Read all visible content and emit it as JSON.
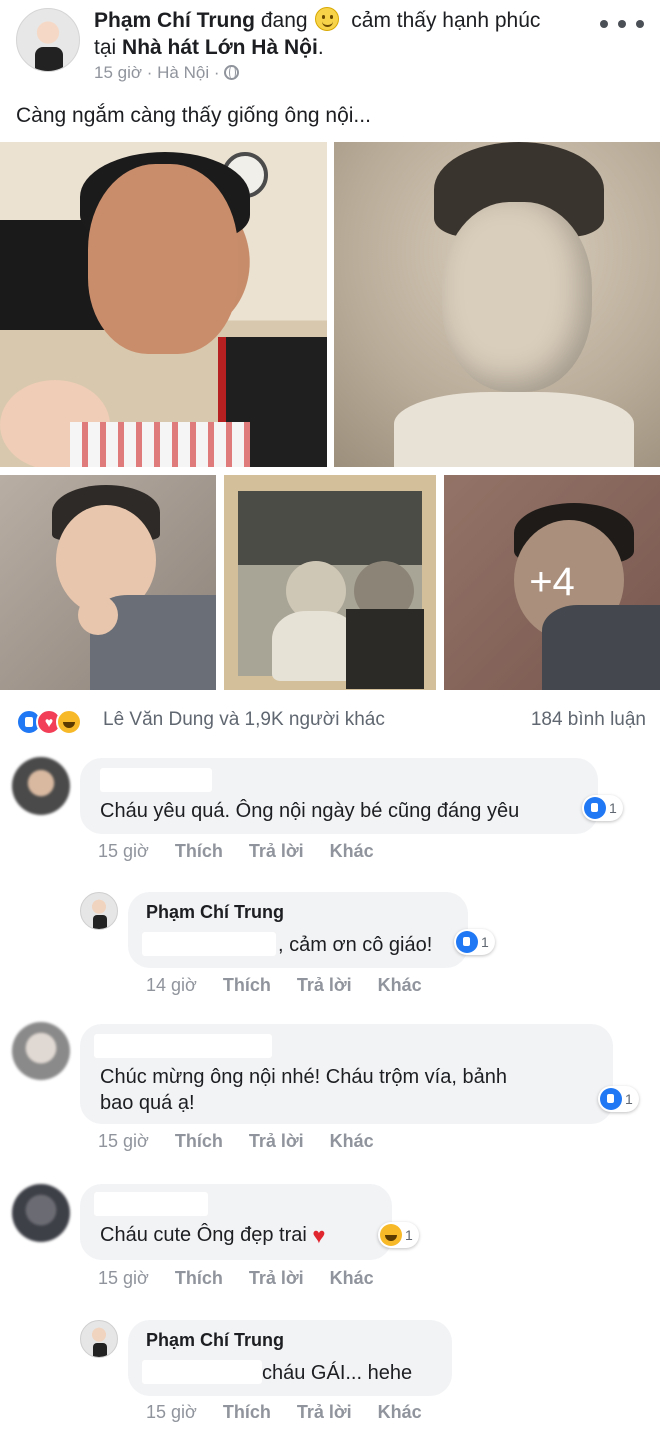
{
  "post": {
    "author": "Phạm Chí Trung",
    "status_verb": "đang",
    "feeling": "cảm thấy hạnh phúc",
    "at_word": "tại",
    "location": "Nhà hát Lớn Hà Nội",
    "location_suffix": ".",
    "time": "15 giờ",
    "separator": "·",
    "place": "Hà Nội",
    "privacy_icon": "globe-icon",
    "text": "Càng ngắm càng thấy giống ông nội...",
    "more_photos": "+4"
  },
  "reactions": {
    "icons": [
      "like-icon",
      "love-icon",
      "haha-icon"
    ],
    "names": "Lê Văn Dung và 1,9K người khác",
    "comments": "184 bình luận"
  },
  "actions": {
    "like": "Thích",
    "reply": "Trả lời",
    "more": "Khác"
  },
  "comments": [
    {
      "name": "",
      "text": "Cháu yêu quá. Ông nội ngày bé cũng đáng yêu",
      "reaction_count": "1",
      "time": "15 giờ"
    },
    {
      "name": "Phạm Chí Trung",
      "text": ", cảm ơn cô giáo!",
      "reaction_count": "1",
      "time": "14 giờ"
    },
    {
      "name": "",
      "text_line1": "Chúc mừng ông nội nhé! Cháu trộm vía, bảnh",
      "text_line2": "bao quá ạ!",
      "reaction_count": "1",
      "time": "15 giờ"
    },
    {
      "name": "",
      "text": "Cháu cute Ông đẹp trai",
      "reaction_count": "1",
      "time": "15 giờ"
    },
    {
      "name": "Phạm Chí Trung",
      "text": "cháu GÁI... hehe",
      "time": "15 giờ"
    }
  ]
}
